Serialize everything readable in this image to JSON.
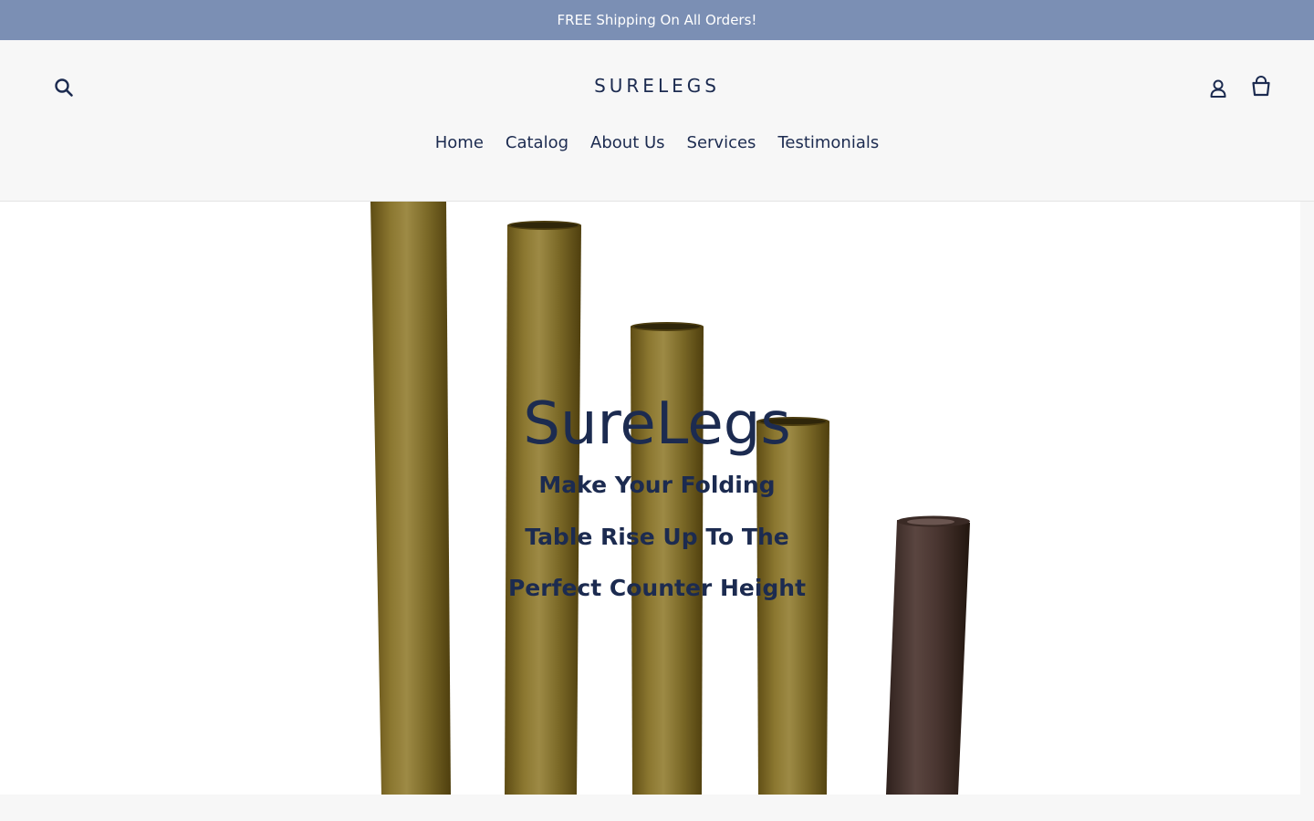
{
  "announcement": {
    "text": "FREE Shipping On All Orders!"
  },
  "header": {
    "logo": "SURELEGS",
    "search_icon": "search-icon",
    "login_icon": "user-icon",
    "cart_icon": "cart-icon"
  },
  "nav": {
    "items": [
      {
        "label": "Home"
      },
      {
        "label": "Catalog"
      },
      {
        "label": "About Us"
      },
      {
        "label": "Services"
      },
      {
        "label": "Testimonials"
      }
    ]
  },
  "hero": {
    "title": "SureLegs",
    "subtitle_lines": [
      "Make Your Folding",
      "Table Rise Up To The",
      "Perfect Counter Height"
    ]
  },
  "colors": {
    "announcement_bg": "#7b8fb4",
    "brand_text": "#1c2b50",
    "header_bg": "#f7f7f7",
    "tube_gold": "#7d6a2a",
    "tube_bronze": "#4a3530"
  }
}
